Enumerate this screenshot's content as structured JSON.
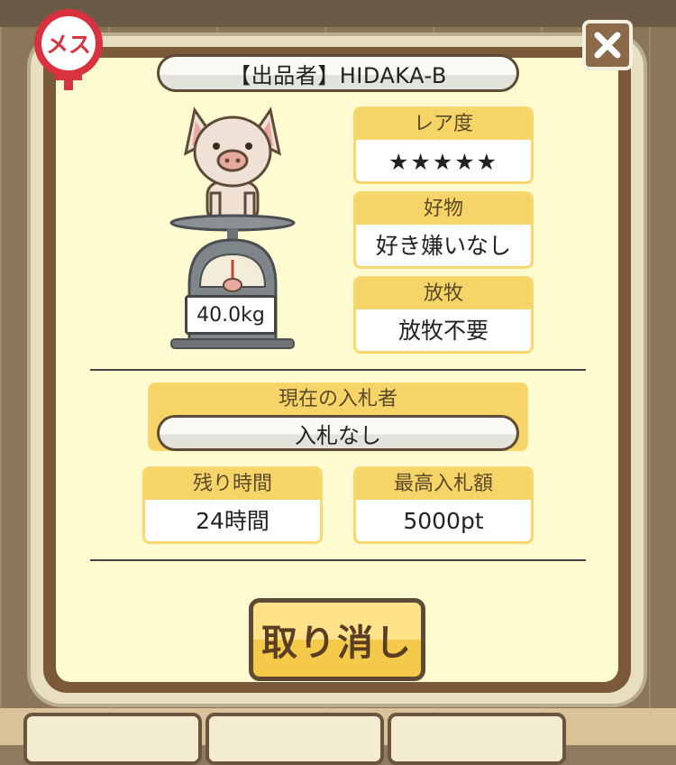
{
  "colors": {
    "panel": "#fffbd0",
    "frame": "#7b5a3a",
    "card_header": "#f7d468",
    "star": "#e0897c",
    "badge": "#d8323e"
  },
  "badge": {
    "label": "メス",
    "icon": "female-symbol-icon"
  },
  "close": {
    "icon": "close-icon"
  },
  "seller": {
    "text": "【出品者】HIDAKA-B"
  },
  "pig": {
    "weight": "40.0kg"
  },
  "rarity": {
    "label": "レア度",
    "stars": "★★★★★",
    "value": 5,
    "max": 5
  },
  "favorite": {
    "label": "好物",
    "value": "好き嫌いなし"
  },
  "grazing": {
    "label": "放牧",
    "value": "放牧不要"
  },
  "bidder": {
    "label": "現在の入札者",
    "value": "入札なし"
  },
  "remaining": {
    "label": "残り時間",
    "value": "24時間"
  },
  "highest_bid": {
    "label": "最高入札額",
    "value": "5000pt"
  },
  "cancel": {
    "label": "取り消し"
  }
}
